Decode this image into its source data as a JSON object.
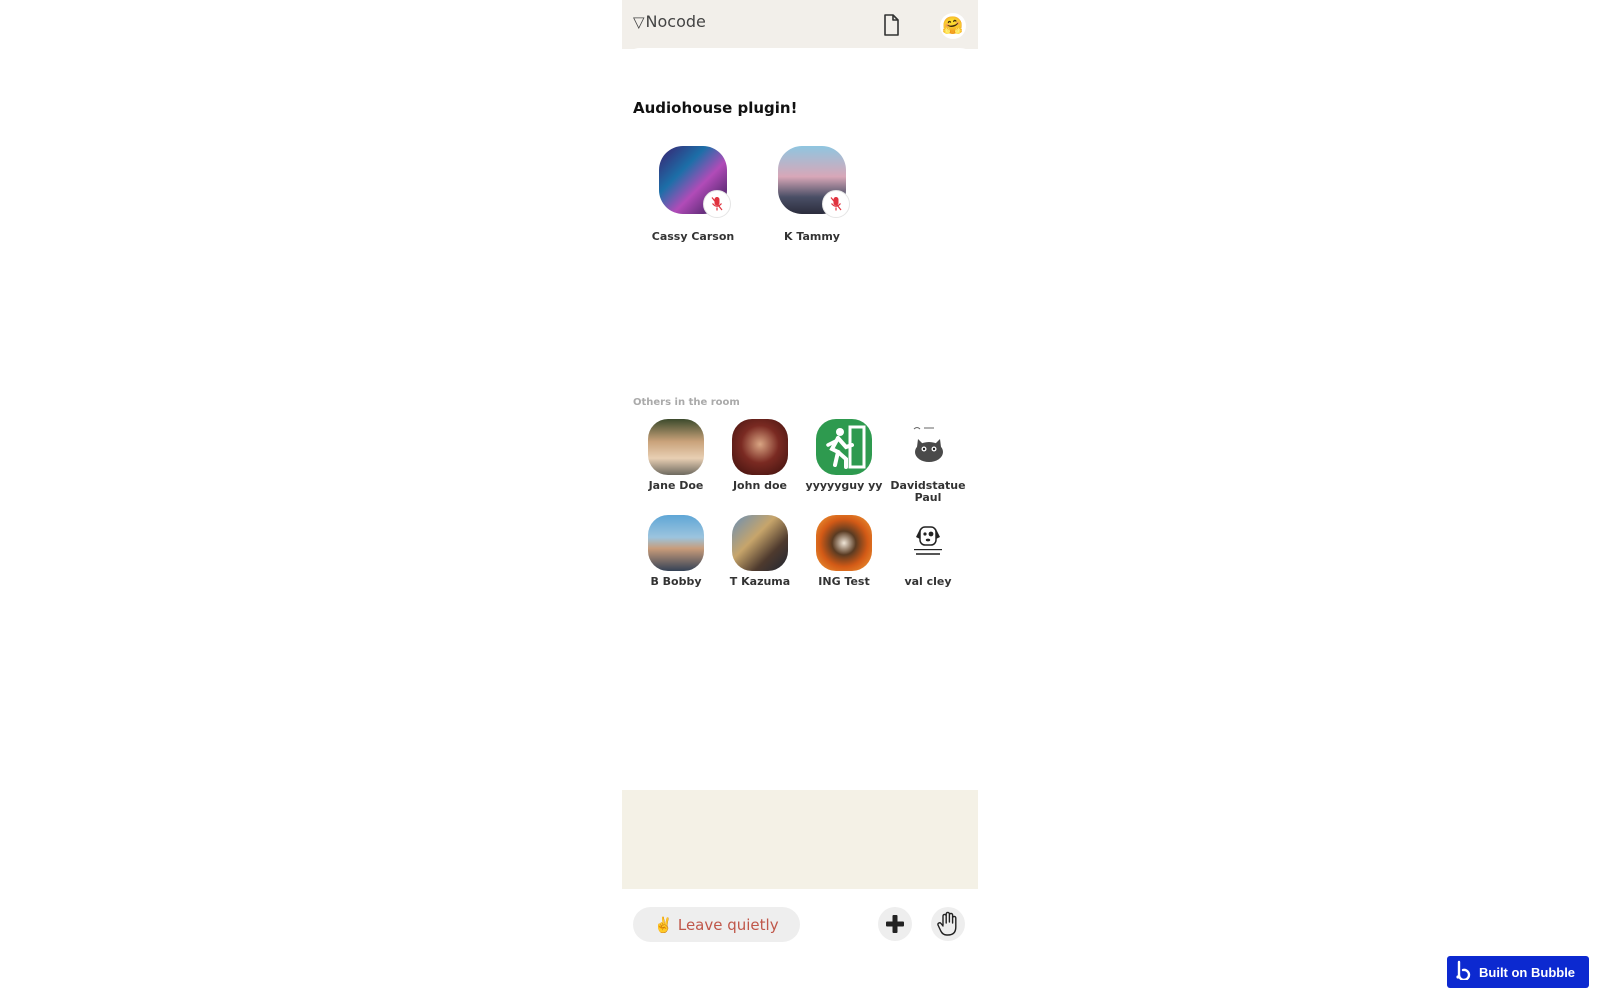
{
  "app": {
    "logo_mark": "▽",
    "logo_text": "Nocode"
  },
  "header": {
    "doc_icon": "document-icon",
    "profile_emoji": "🤗"
  },
  "room": {
    "title": "Audiohouse plugin!"
  },
  "speakers": [
    {
      "name": "Cassy Carson",
      "muted": true
    },
    {
      "name": "K Tammy",
      "muted": true
    }
  ],
  "others": {
    "label": "Others in the room",
    "people": [
      {
        "name": "Jane Doe"
      },
      {
        "name": "John doe"
      },
      {
        "name": "yyyyyguy yy"
      },
      {
        "name": "Davidstatue Paul"
      },
      {
        "name": "B Bobby"
      },
      {
        "name": "T Kazuma"
      },
      {
        "name": "ING Test"
      },
      {
        "name": "val cley"
      }
    ]
  },
  "footer": {
    "leave_label": "✌️ Leave quietly",
    "add_icon": "plus-icon",
    "raise_hand_icon": "raise-hand-icon"
  },
  "badge": {
    "label": "Built on Bubble"
  },
  "colors": {
    "leave_text": "#c0574a",
    "muted_mic": "#e0333f",
    "bubble_blue": "#0c29d0",
    "topbar_bg": "#f2efea"
  }
}
